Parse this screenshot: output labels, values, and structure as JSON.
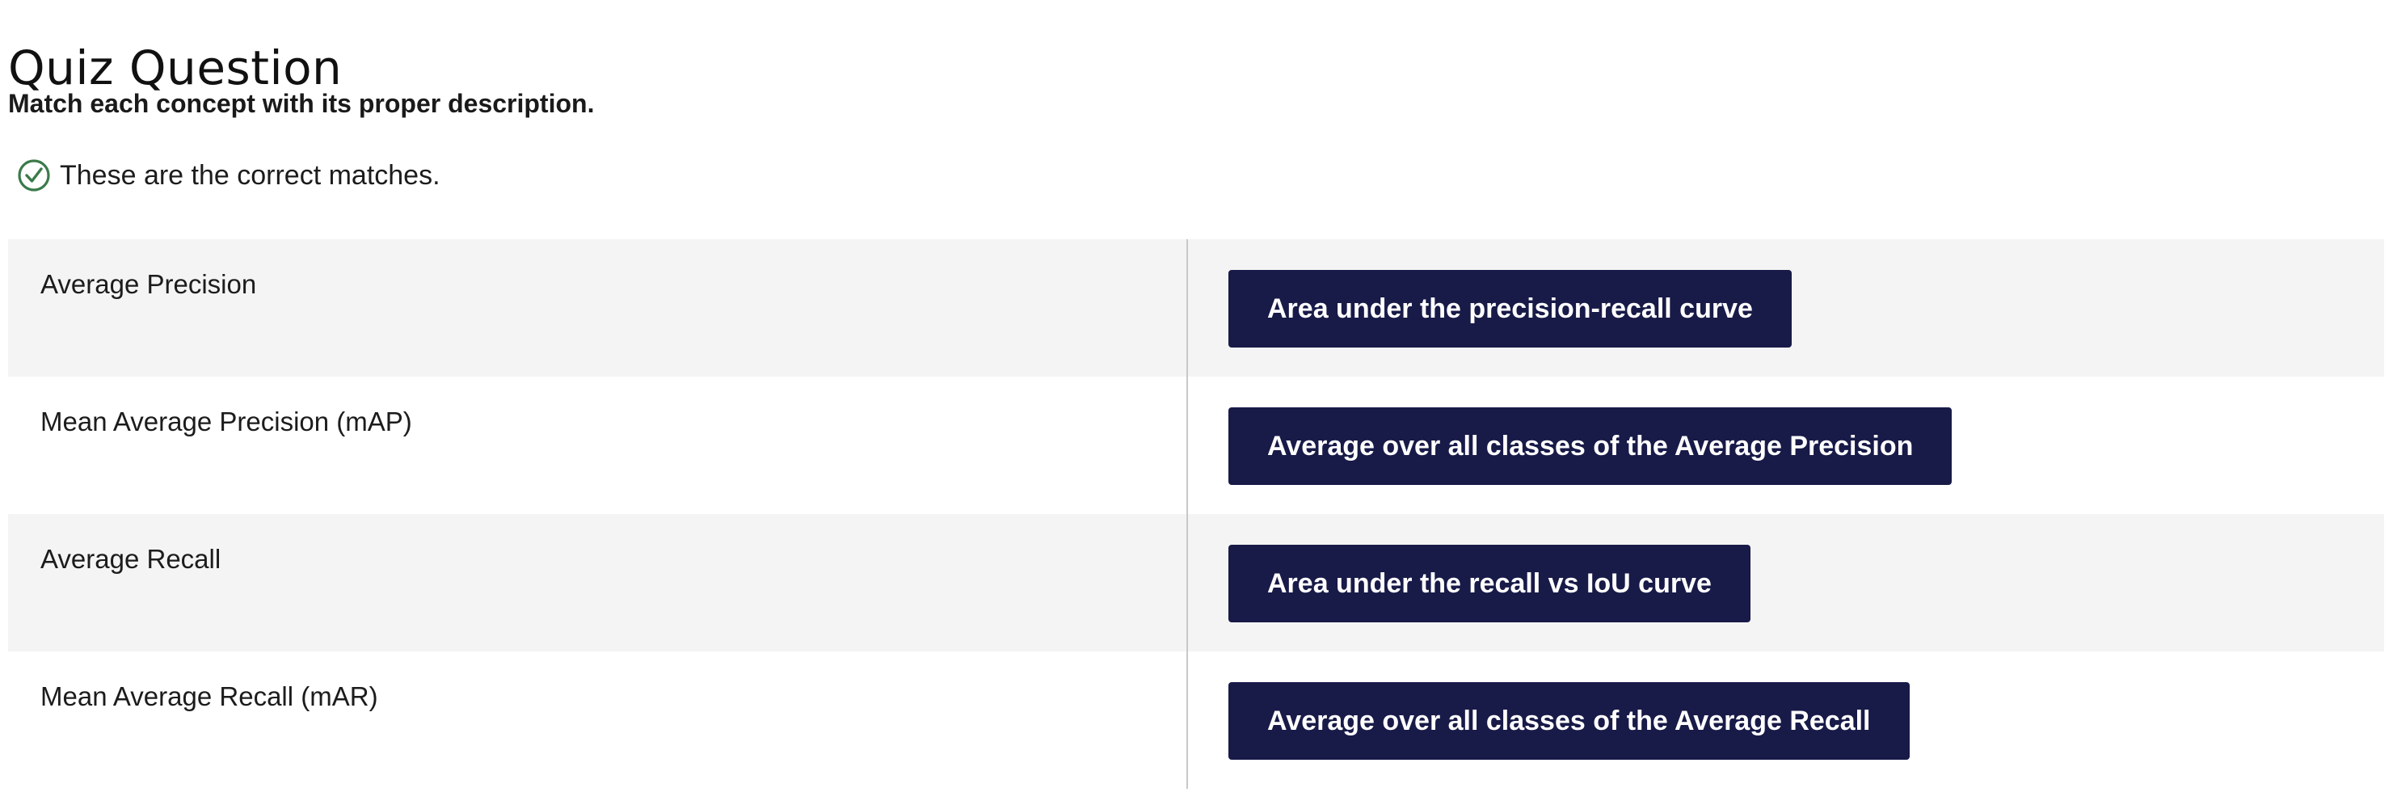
{
  "page": {
    "title": "Quiz Question",
    "question": "Match each concept with its proper description."
  },
  "feedback": {
    "icon": "check-circle-icon",
    "message": "These are the correct matches.",
    "color": "#3a7a4a"
  },
  "matches": [
    {
      "concept": "Average Precision",
      "answer": "Area under the precision-recall curve"
    },
    {
      "concept": "Mean Average Precision (mAP)",
      "answer": "Average over all classes of the Average Precision"
    },
    {
      "concept": "Average Recall",
      "answer": "Area under the recall vs IoU curve"
    },
    {
      "concept": "Mean Average Recall (mAR)",
      "answer": "Average over all classes of the Average Recall"
    }
  ],
  "colors": {
    "chip_background": "#181a48",
    "row_shaded": "#f4f4f4",
    "divider": "#c8c8c8"
  }
}
